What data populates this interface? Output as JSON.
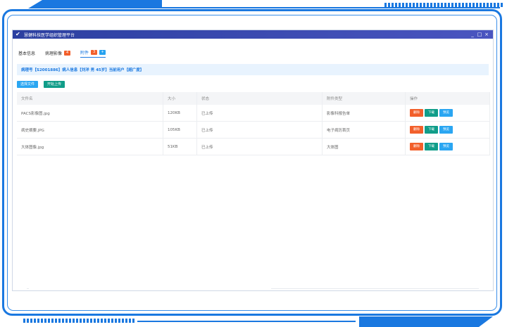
{
  "window": {
    "title": "慧健科技医学组织管理平台",
    "controls": [
      "_",
      "□",
      "×"
    ]
  },
  "tabs": [
    {
      "label": "基本信息",
      "badge": ""
    },
    {
      "label": "病理影像",
      "badge": "4"
    },
    {
      "label": "附件",
      "badge": "3",
      "badge2": "+"
    }
  ],
  "info": "病理号【S2001886】病人信息【刘洋 男 45岁】当前用户【超广度】",
  "toolbar": {
    "select_label": "选择文件",
    "upload_label": "开始上传"
  },
  "table": {
    "headers": [
      "文件名",
      "大小",
      "状态",
      "附件类型",
      "操作"
    ],
    "rows": [
      {
        "name": "PACS影像图.jpg",
        "size": "120KB",
        "status": "已上传",
        "type": "影像科报告单"
      },
      {
        "name": "病史摘要.JPG",
        "size": "105KB",
        "status": "已上传",
        "type": "电子病历首页"
      },
      {
        "name": "大体图像.jpg",
        "size": "51KB",
        "status": "已上传",
        "type": "大体图"
      }
    ],
    "actions": {
      "delete": "删除",
      "download": "下载",
      "preview": "预览"
    }
  },
  "colors": {
    "accent": "#1a78e0",
    "danger": "#f25f2b",
    "success": "#109d89",
    "info": "#2aa6f2"
  }
}
